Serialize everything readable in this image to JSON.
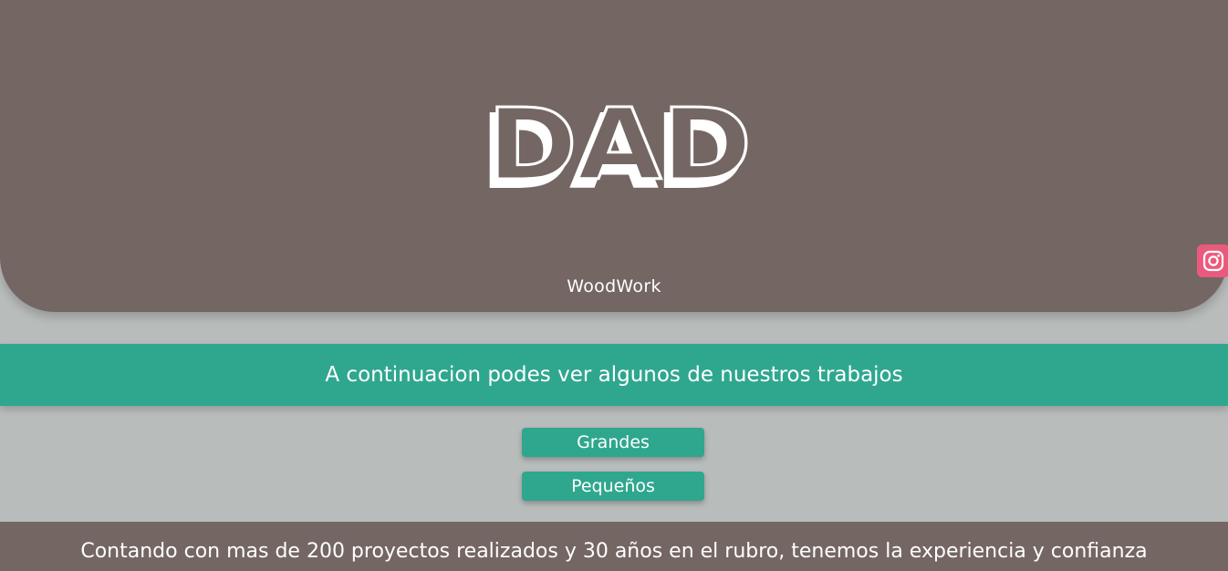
{
  "colors": {
    "hero_bg": "#746663",
    "accent": "#2fa78e",
    "page_bg": "#b8bcba",
    "instagram": "#ea5a7c"
  },
  "hero": {
    "logo_text": "DAD",
    "subtitle": "WoodWork"
  },
  "social": {
    "icon": "instagram-icon"
  },
  "banner": {
    "text": "A continuacion podes ver algunos de nuestros trabajos"
  },
  "buttons": {
    "grandes": "Grandes",
    "pequenos": "Pequeños"
  },
  "footer": {
    "text": "Contando con mas de 200 proyectos realizados y 30 años en el rubro, tenemos la experiencia y confianza"
  }
}
